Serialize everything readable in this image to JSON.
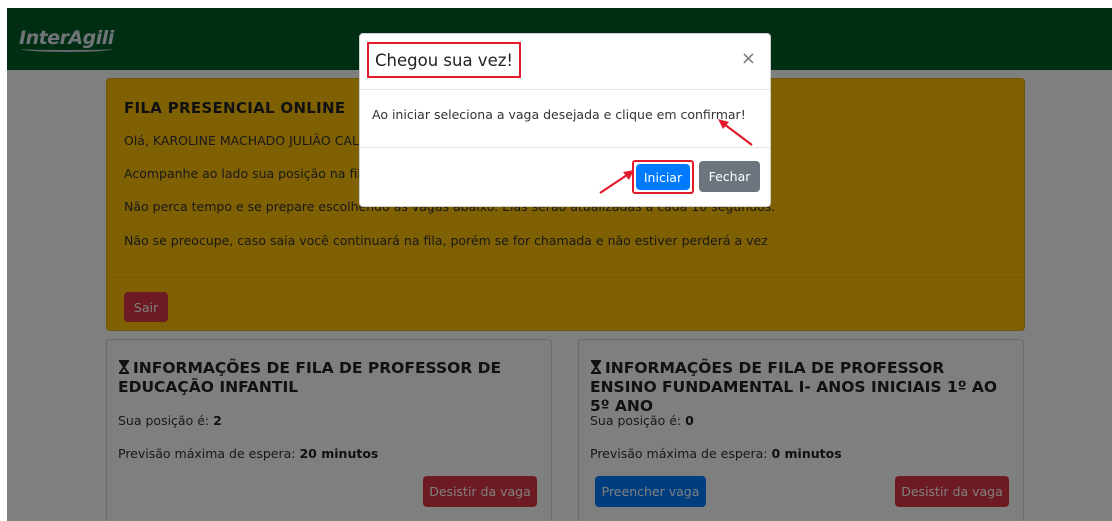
{
  "app": {
    "logo_text": "InterAgili"
  },
  "queue_card": {
    "title": "FILA PRESENCIAL ONLINE",
    "greeting": "Olá, KAROLINE MACHADO JULIÃO CALE",
    "line_position": "Acompanhe ao lado sua posição na fila.",
    "line_time": "Não perca tempo e se prepare escolhendo as vagas abaixo. Elas serão atualizadas a cada 10 segundos.",
    "line_warning": "Não se preocupe, caso saia você continuará na fila, porém se for chamada e não estiver perderá a vez",
    "exit_label": "Sair"
  },
  "queues": [
    {
      "title": "INFORMAÇÕES DE FILA DE PROFESSOR DE EDUCAÇÃO INFANTIL",
      "position_label": "Sua posição é:",
      "position_value": "2",
      "wait_label": "Previsão máxima de espera:",
      "wait_value": "20 minutos",
      "withdraw_label": "Desistir da vaga"
    },
    {
      "title": "INFORMAÇÕES DE FILA DE PROFESSOR ENSINO FUNDAMENTAL I- ANOS INICIAIS 1º AO 5º ANO",
      "position_label": "Sua posição é:",
      "position_value": "0",
      "wait_label": "Previsão máxima de espera:",
      "wait_value": "0 minutos",
      "fill_label": "Preencher vaga",
      "withdraw_label": "Desistir da vaga"
    }
  ],
  "modal": {
    "title": "Chegou sua vez!",
    "close_glyph": "×",
    "body": "Ao iniciar seleciona a vaga desejada e clique em confirmar!",
    "start_label": "Iniciar",
    "close_label": "Fechar"
  },
  "colors": {
    "topbar": "#005c24",
    "warning": "#ffc107",
    "danger": "#dc3545",
    "primary": "#007bff",
    "secondary": "#6c757d",
    "annotation": "#e01b2c"
  }
}
